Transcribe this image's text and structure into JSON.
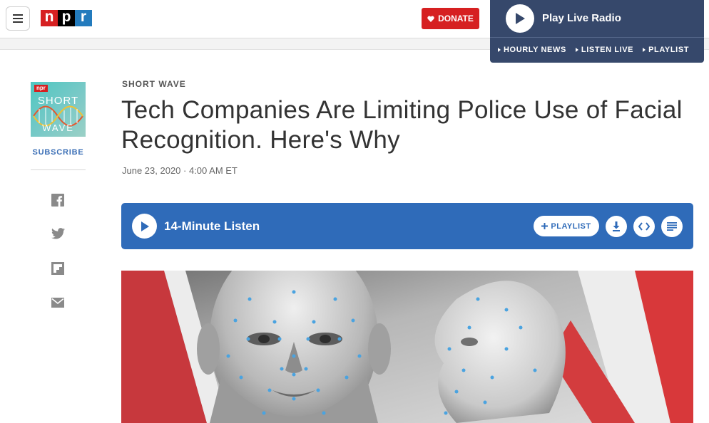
{
  "header": {
    "logo_letters": [
      "n",
      "p",
      "r"
    ],
    "logo_colors": [
      "#d62021",
      "#000000",
      "#237bbd"
    ],
    "donate_label": "DONATE",
    "menu_icon": "hamburger-icon"
  },
  "live_radio": {
    "title": "Play Live Radio",
    "links": [
      "HOURLY NEWS",
      "LISTEN LIVE",
      "PLAYLIST"
    ]
  },
  "sidebar": {
    "podcast_art": {
      "badge": "npr",
      "line1": "SHORT",
      "line2": "WAVE"
    },
    "subscribe_label": "SUBSCRIBE",
    "share_icons": [
      "facebook-icon",
      "twitter-icon",
      "flipboard-icon",
      "email-icon"
    ]
  },
  "article": {
    "slug": "SHORT WAVE",
    "headline": "Tech Companies Are Limiting Police Use of Facial Recognition. Here's Why",
    "dateline": "June 23, 2020 · 4:00 AM ET"
  },
  "player": {
    "title": "14-Minute Listen",
    "playlist_label": "PLAYLIST",
    "icons": [
      "download-icon",
      "embed-icon",
      "transcript-icon"
    ]
  },
  "colors": {
    "brand_red": "#d62021",
    "radio_navy": "#36486b",
    "player_blue": "#2f6bb9"
  }
}
